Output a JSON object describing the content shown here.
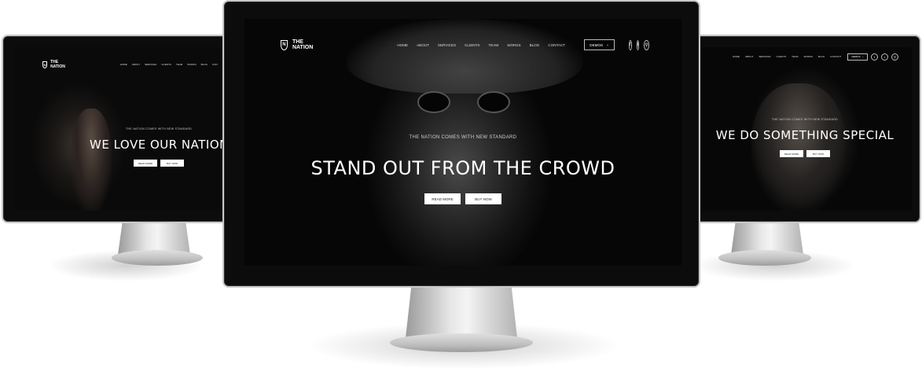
{
  "center": {
    "logo_letter": "N",
    "logo_text": "THE NATION",
    "menu": [
      "HOME",
      "ABOUT",
      "SERVICES",
      "CLIENTS",
      "TEAM",
      "WORKS",
      "BLOG",
      "CONTACT"
    ],
    "demos_label": "DEMOS",
    "social": {
      "facebook": "f",
      "twitter": "t",
      "search": "⚲"
    },
    "kicker": "THE NATION COMES WITH NEW STANDARD",
    "headline": "STAND OUT FROM THE CROWD",
    "btn_read": "READ MORE",
    "btn_buy": "BUY NOW"
  },
  "left": {
    "logo_letter": "N",
    "logo_text": "THE NATION",
    "menu": [
      "HOME",
      "ABOUT",
      "SERVICES",
      "CLIENTS",
      "TEAM",
      "WORKS",
      "BLOG",
      "CON"
    ],
    "kicker": "THE NATION COMES WITH NEW STANDARD",
    "headline": "WE LOVE OUR NATION",
    "btn_read": "READ MORE",
    "btn_buy": "BUY NOW"
  },
  "right": {
    "menu": [
      "HOME",
      "ABOUT",
      "SERVICES",
      "CLIENTS",
      "TEAM",
      "WORKS",
      "BLOG",
      "CONTACT"
    ],
    "demos_label": "DEMOS",
    "social": {
      "facebook": "f",
      "twitter": "t",
      "search": "⚲"
    },
    "kicker": "THE NATION COMES WITH NEW STANDARD",
    "headline": "WE DO SOMETHING SPECIAL",
    "btn_read": "READ MORE",
    "btn_buy": "BUY NOW"
  }
}
